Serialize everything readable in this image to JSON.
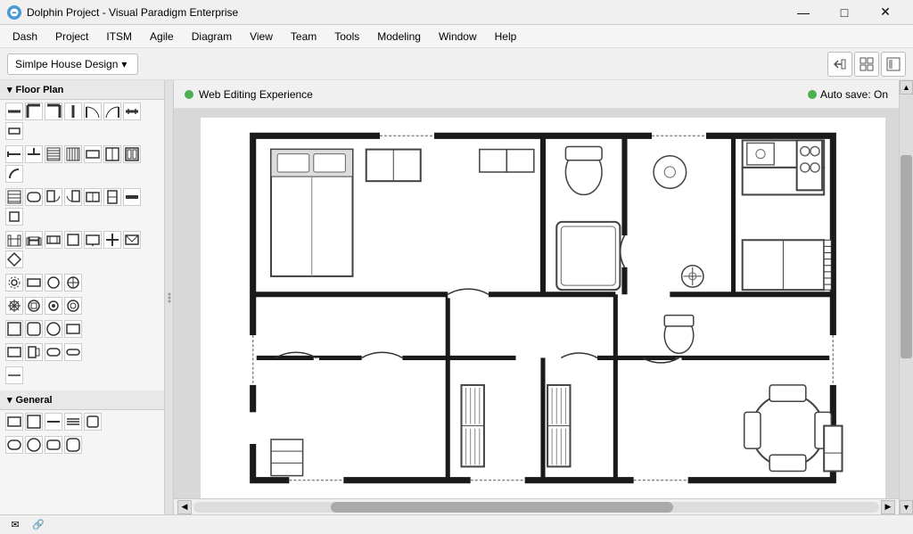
{
  "titlebar": {
    "title": "Dolphin Project - Visual Paradigm Enterprise",
    "icon": "🐬",
    "min_btn": "—",
    "max_btn": "□",
    "close_btn": "✕"
  },
  "menubar": {
    "items": [
      "Dash",
      "Project",
      "ITSM",
      "Agile",
      "Diagram",
      "View",
      "Team",
      "Tools",
      "Modeling",
      "Window",
      "Help"
    ]
  },
  "toolbar": {
    "breadcrumb": "Simlpe House Design",
    "btn1": "↩",
    "btn2": "⊞",
    "btn3": "□"
  },
  "left_panel": {
    "section1": {
      "label": "Floor Plan",
      "arrow": "▾"
    },
    "section2": {
      "label": "General",
      "arrow": "▾"
    }
  },
  "canvas": {
    "tab_label": "Web Editing Experience",
    "autosave": "Auto save: On",
    "green_dot": "●"
  },
  "statusbar": {
    "email_icon": "✉",
    "link_icon": "🔗"
  },
  "scrollbar": {
    "left_arrow": "◀",
    "right_arrow": "▶",
    "up_arrow": "▲",
    "down_arrow": "▼"
  }
}
